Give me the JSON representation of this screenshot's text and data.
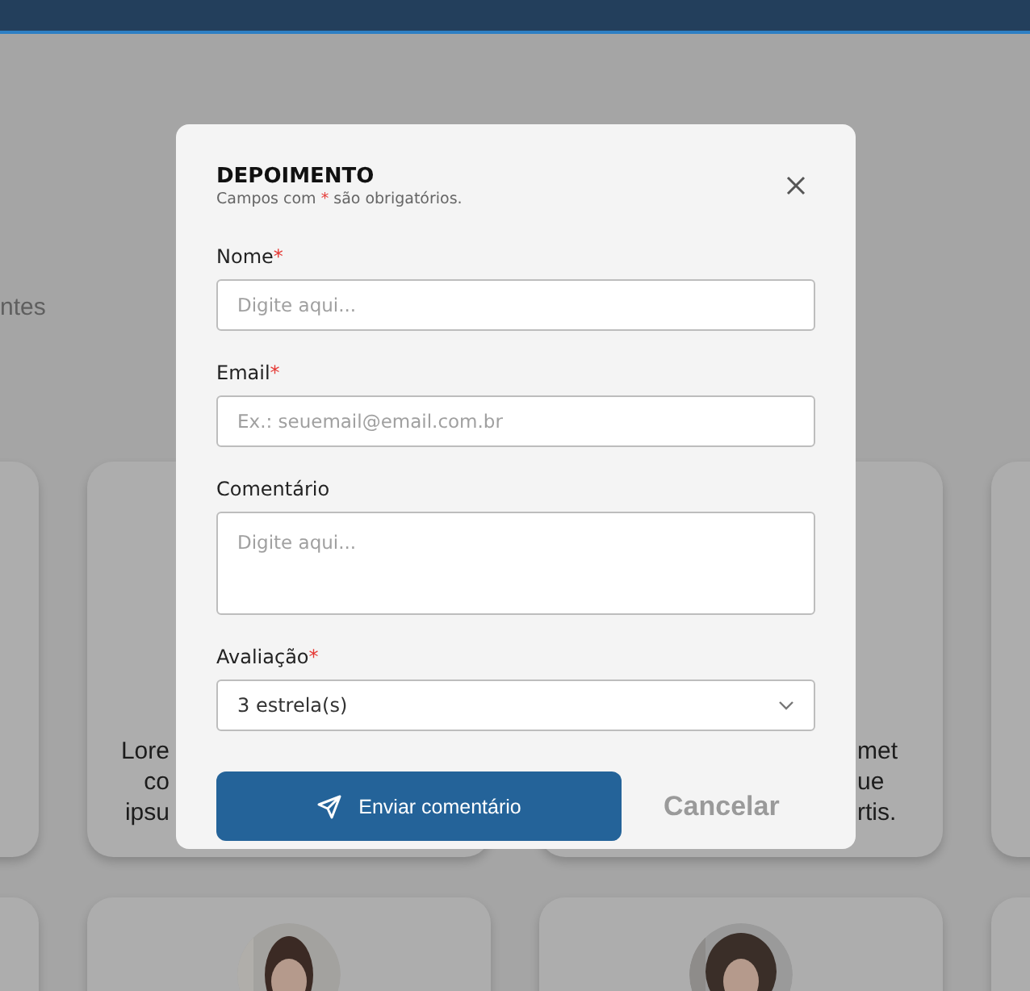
{
  "background": {
    "section_text": "ntes",
    "card_rows": [
      {
        "cards": [
          {
            "kind": "plain"
          },
          {
            "kind": "text",
            "lines": [
              "Lore",
              "co",
              "ipsu"
            ]
          },
          {
            "kind": "text",
            "lines": [
              "met",
              "ue",
              "rtis."
            ]
          },
          {
            "kind": "plain"
          }
        ]
      },
      {
        "cards": [
          {
            "kind": "plain"
          },
          {
            "kind": "avatar"
          },
          {
            "kind": "avatar"
          },
          {
            "kind": "plain"
          }
        ]
      }
    ]
  },
  "modal": {
    "title": "DEPOIMENTO",
    "subtitle": {
      "before": "Campos com",
      "mark": "*",
      "after": "são obrigatórios."
    },
    "required_mark": "*",
    "fields": [
      {
        "kind": "text",
        "label": "Nome",
        "required": true,
        "placeholder": "Digite aqui..."
      },
      {
        "kind": "text",
        "label": "Email",
        "required": true,
        "placeholder": "Ex.: seuemail@email.com.br"
      },
      {
        "kind": "textarea",
        "label": "Comentário",
        "required": false,
        "placeholder": "Digite aqui..."
      },
      {
        "kind": "select",
        "label": "Avaliação",
        "required": true,
        "value": "3 estrela(s)"
      }
    ],
    "submit_button": "Enviar comentário",
    "cancel_button": "Cancelar"
  }
}
